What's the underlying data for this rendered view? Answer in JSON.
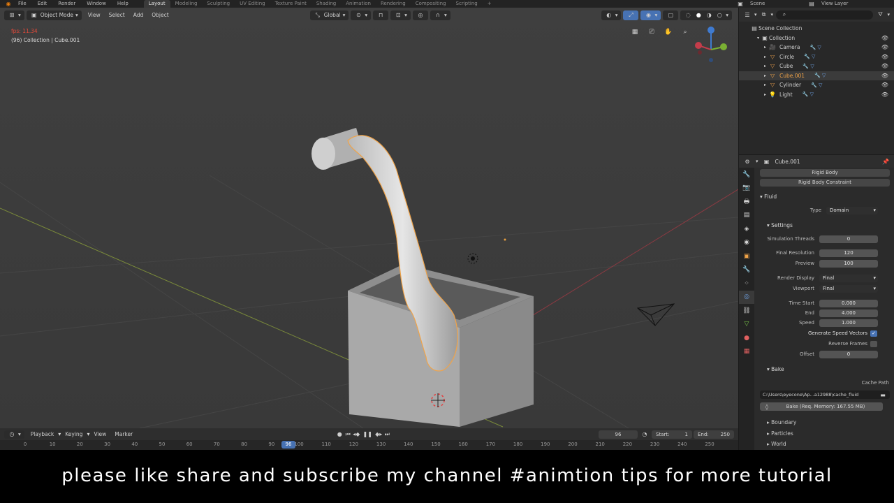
{
  "menu": {
    "items": [
      "File",
      "Edit",
      "Render",
      "Window",
      "Help"
    ],
    "workspaces": [
      "Layout",
      "Modeling",
      "Sculpting",
      "UV Editing",
      "Texture Paint",
      "Shading",
      "Animation",
      "Rendering",
      "Compositing",
      "Scripting"
    ],
    "active_workspace": "Layout",
    "scene_label": "Scene",
    "view_layer_label": "View Layer"
  },
  "viewport": {
    "mode": "Object Mode",
    "menus": [
      "View",
      "Select",
      "Add",
      "Object"
    ],
    "orientation": "Global",
    "fps_overlay": "fps: 11.34",
    "collection_overlay": "(96) Collection | Cube.001",
    "gizmo_axes": {
      "x": "X",
      "y": "Y",
      "z": "Z"
    }
  },
  "timeline": {
    "menus": [
      "Playback",
      "Keying",
      "View",
      "Marker"
    ],
    "current_frame": "96",
    "start_label": "Start:",
    "start": "1",
    "end_label": "End:",
    "end": "250",
    "ruler_ticks": [
      "0",
      "10",
      "20",
      "30",
      "40",
      "50",
      "60",
      "70",
      "80",
      "90",
      "100",
      "110",
      "120",
      "130",
      "140",
      "150",
      "160",
      "170",
      "180",
      "190",
      "200",
      "210",
      "220",
      "230",
      "240",
      "250"
    ],
    "playhead_label": "96"
  },
  "outliner": {
    "root": "Scene Collection",
    "collection": "Collection",
    "items": [
      {
        "name": "Camera",
        "color": "#e39b4a"
      },
      {
        "name": "Circle",
        "color": "#e39b4a"
      },
      {
        "name": "Cube",
        "color": "#e39b4a"
      },
      {
        "name": "Cube.001",
        "color": "#f0a348",
        "selected": true
      },
      {
        "name": "Cylinder",
        "color": "#e39b4a"
      },
      {
        "name": "Light",
        "color": "#e39b4a"
      }
    ]
  },
  "properties": {
    "object_name": "Cube.001",
    "rigid_body_btn": "Rigid Body",
    "rigid_body_constraint_btn": "Rigid Body Constraint",
    "fluid_panel": "Fluid",
    "type_label": "Type",
    "type_value": "Domain",
    "settings_panel": "Settings",
    "fields": [
      {
        "label": "Simulation Threads",
        "value": "0"
      },
      {
        "label": "Final Resolution",
        "value": "120"
      },
      {
        "label": "Preview",
        "value": "100"
      }
    ],
    "render_display_label": "Render Display",
    "render_display_value": "Final",
    "viewport_label": "Viewport",
    "viewport_value": "Final",
    "time_fields": [
      {
        "label": "Time Start",
        "value": "0.000"
      },
      {
        "label": "End",
        "value": "4.000"
      },
      {
        "label": "Speed",
        "value": "1.000"
      }
    ],
    "gen_speed_vectors": "Generate Speed Vectors",
    "reverse_frames": "Reverse Frames",
    "offset_label": "Offset",
    "offset_value": "0",
    "bake_panel": "Bake",
    "cache_path_label": "Cache Path",
    "cache_path_value": "C:\\Users\\eyecone\\Ap...a12988\\cache_fluid",
    "bake_button": "Bake (Req. Memory: 167.55 MB)",
    "sub_panels": [
      "Boundary",
      "Particles",
      "World"
    ]
  },
  "caption": {
    "text": "please like share and subscribe my channel #animtion tips for more tutorial"
  },
  "colors": {
    "selection_orange": "#f0a348",
    "viewport_bg": "#3d3d3d",
    "accent_blue": "#4772b3"
  }
}
